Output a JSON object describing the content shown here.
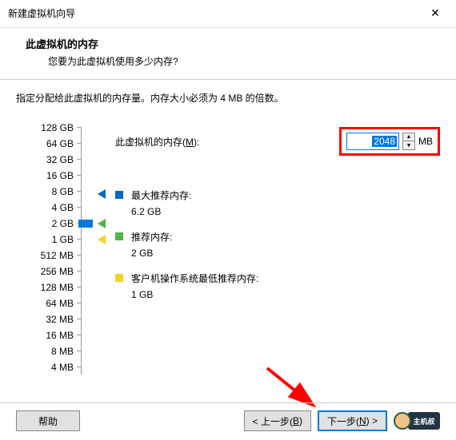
{
  "window": {
    "title": "新建虚拟机向导",
    "close": "✕"
  },
  "header": {
    "heading": "此虚拟机的内存",
    "sub": "您要为此虚拟机使用多少内存?"
  },
  "instruction": "指定分配给此虚拟机的内存量。内存大小必须为 4 MB 的倍数。",
  "memory": {
    "label_pre": "此虚拟机的内存(",
    "label_key": "M",
    "label_post": "):",
    "value": "2048",
    "unit": "MB",
    "spin_up": "▲",
    "spin_down": "▼"
  },
  "scale": {
    "ticks": [
      "128 GB",
      "64 GB",
      "32 GB",
      "16 GB",
      "8 GB",
      "4 GB",
      "2 GB",
      "1 GB",
      "512 MB",
      "256 MB",
      "128 MB",
      "64 MB",
      "32 MB",
      "16 MB",
      "8 MB",
      "4 MB"
    ]
  },
  "info": {
    "max_label": "最大推荐内存:",
    "max_value": "6.2 GB",
    "rec_label": "推荐内存:",
    "rec_value": "2 GB",
    "min_label": "客户机操作系统最低推荐内存:",
    "min_value": "1 GB"
  },
  "footer": {
    "help": "帮助",
    "back_pre": "< 上一步(",
    "back_key": "B",
    "back_post": ")",
    "next_pre": "下一步(",
    "next_key": "N",
    "next_post": ") >"
  },
  "mascot": {
    "text": "主机叔"
  }
}
